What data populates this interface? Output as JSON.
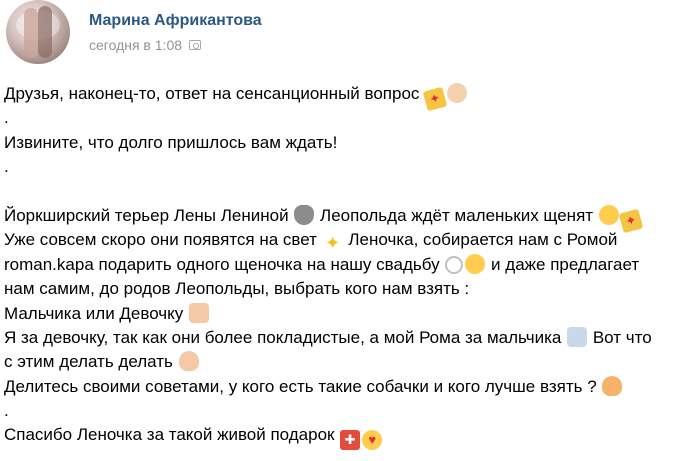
{
  "author": {
    "name": "Марина Африкантова"
  },
  "meta": {
    "time": "сегодня в 1:08"
  },
  "post": {
    "lines": [
      {
        "parts": [
          "Друзья, наконец-то, ответ на сенсанционный вопрос ",
          ""
        ],
        "emoji": [
          "party-popper-emoji",
          "clapping-hands-emoji"
        ]
      },
      {
        "text": "."
      },
      {
        "text": "Извините, что долго пришлось вам ждать!"
      },
      {
        "text": "."
      },
      {
        "text": ""
      },
      {
        "a": "Йоркширский терьер Лены Лениной ",
        "b": " Леопольда ждёт маленьких щенят "
      },
      {
        "a": "Уже совсем скоро они появятся на свет ",
        "b": " Леночка, собирается нам с Ромой"
      },
      {
        "a": "roman.kapa подарить одного щеночка на нашу свадьбу ",
        "b": " и даже предлагает"
      },
      {
        "text": "нам самим, до родов Леопольды, выбрать кого нам взять :"
      },
      {
        "a": "Мальчика или Девочку "
      },
      {
        "a": "Я за девочку, так как они более покладистые, а мой Рома за мальчика ",
        "b": " Вот что"
      },
      {
        "a": "с этим делать делать "
      },
      {
        "a": "Делитесь своими советами, у кого есть такие собачки и кого лучше взять ? "
      },
      {
        "text": "."
      },
      {
        "a": "Спасибо Леночка за такой живой подарок "
      }
    ]
  }
}
